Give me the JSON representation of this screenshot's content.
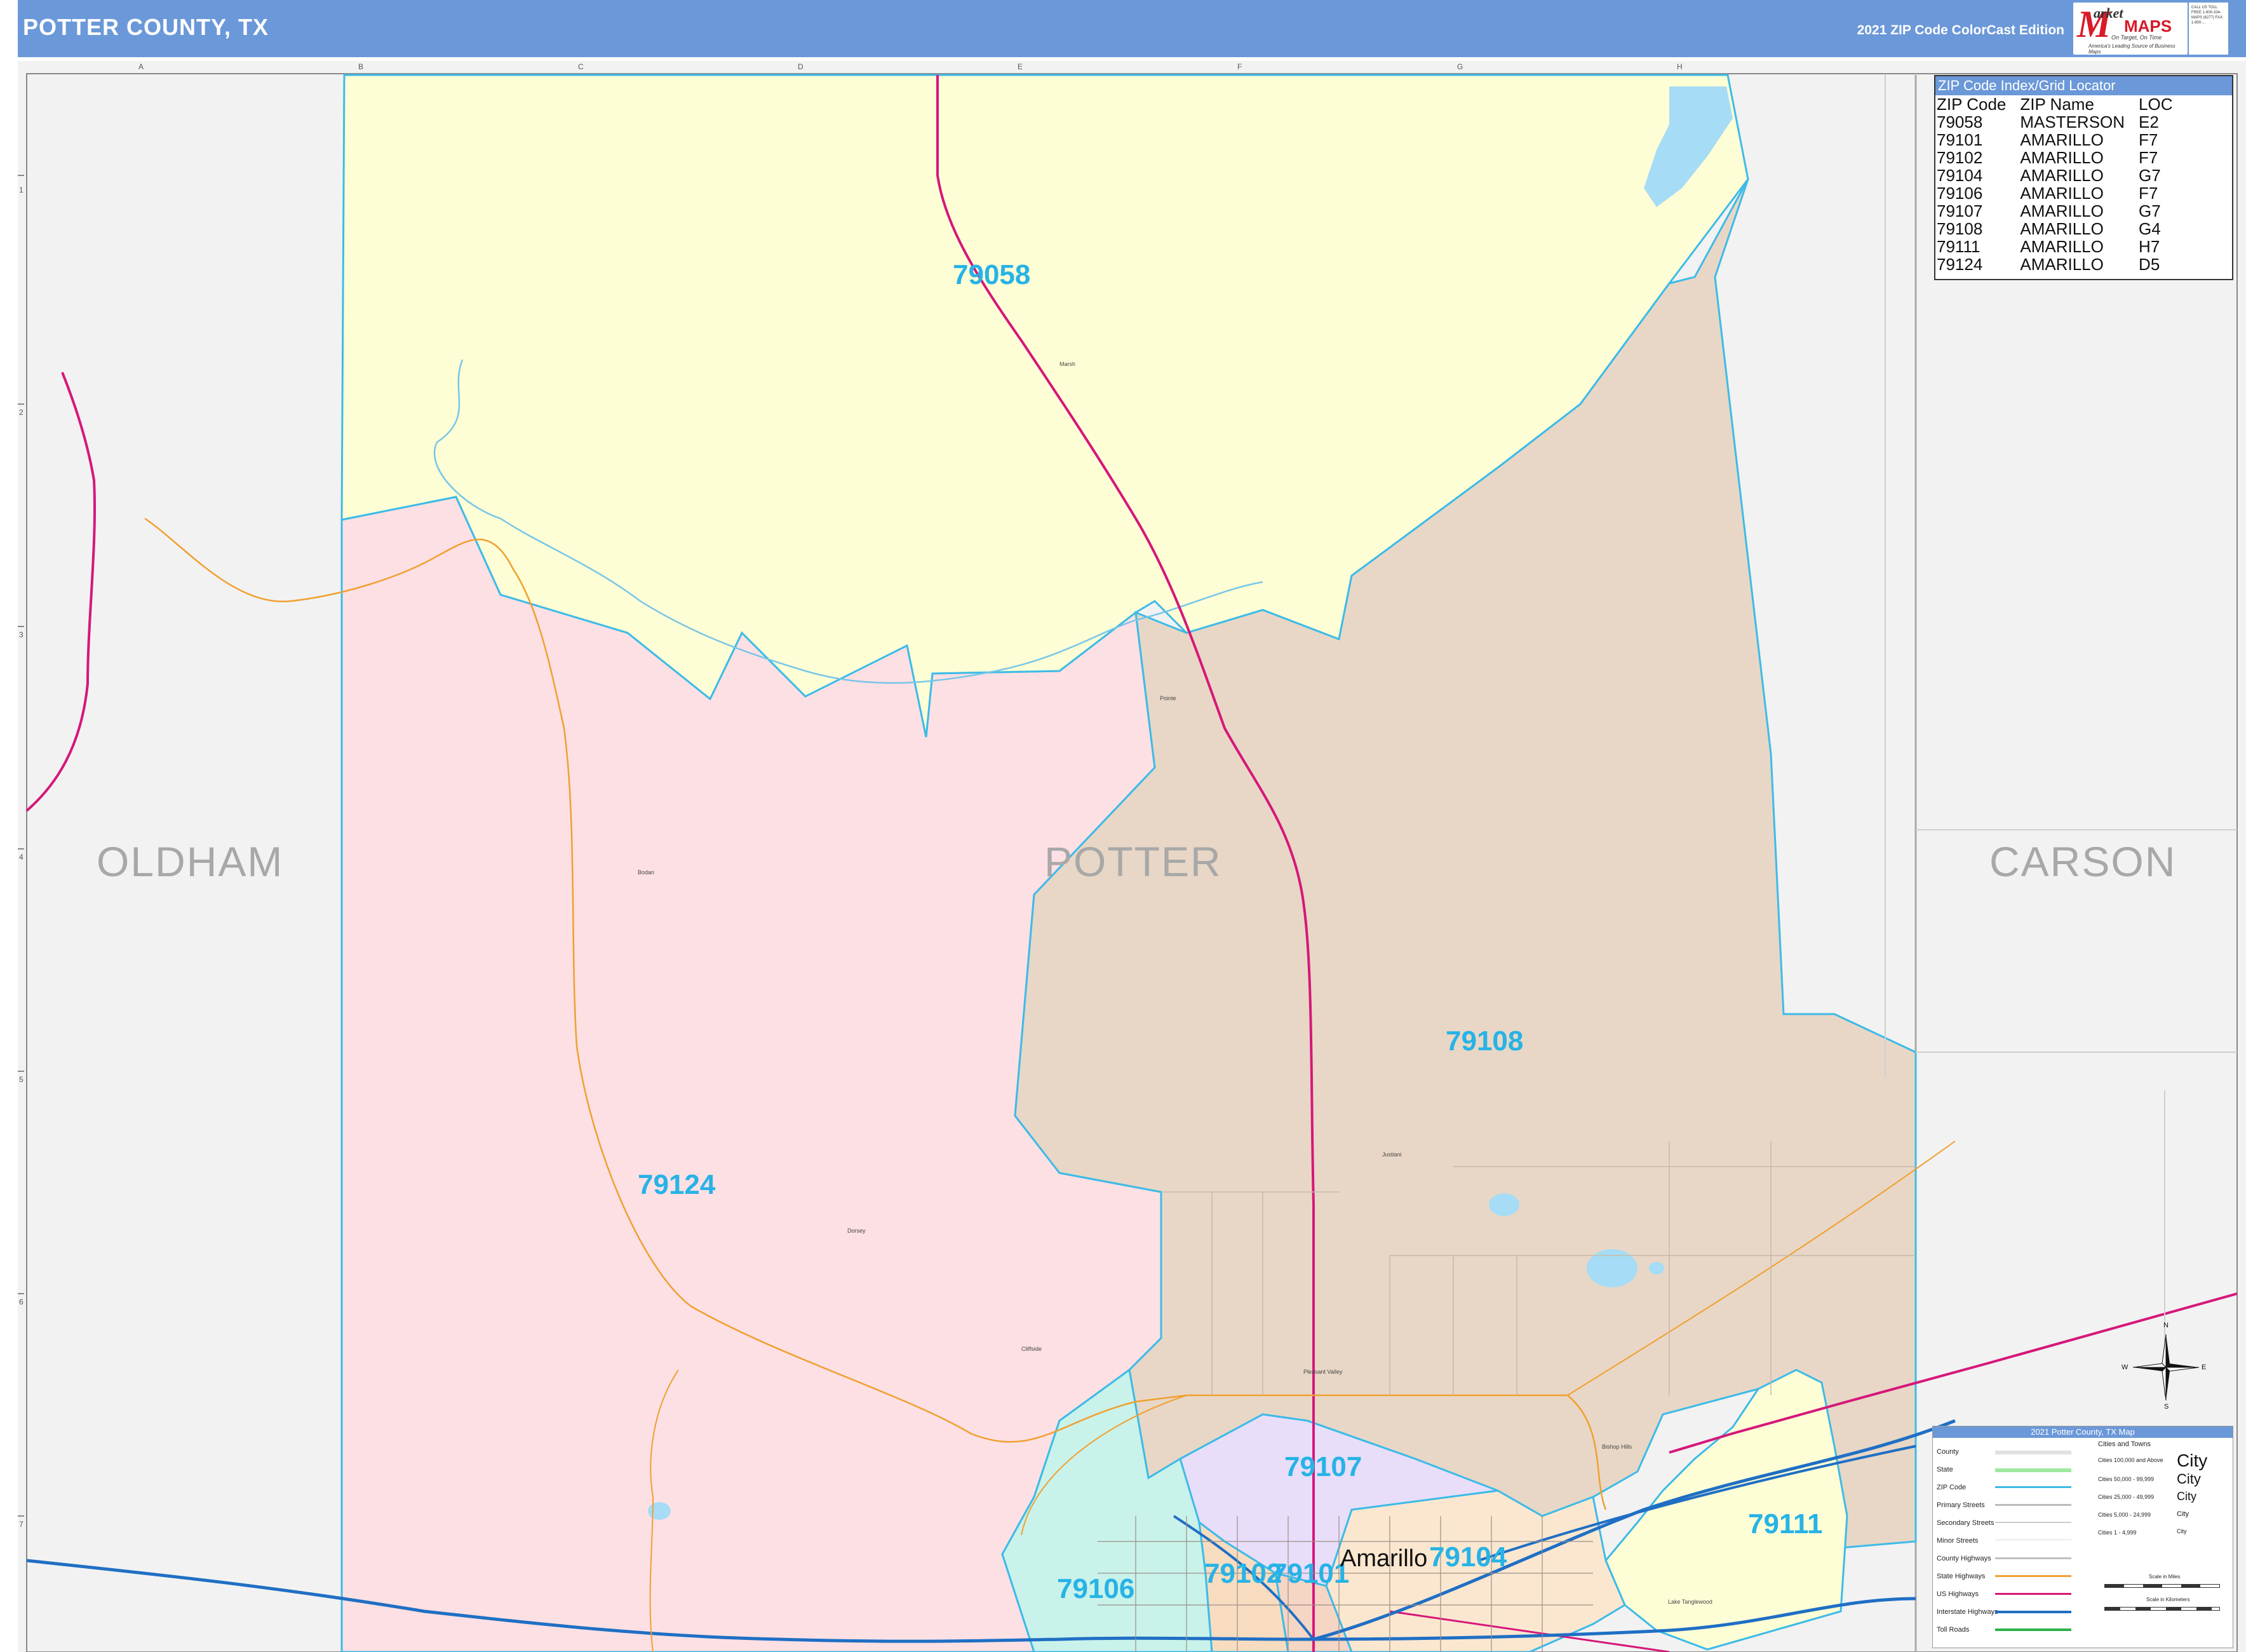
{
  "header": {
    "title": "POTTER COUNTY, TX",
    "edition": "2021 ZIP Code ColorCast Edition",
    "logo": {
      "letter": "M",
      "word1": "arket",
      "word2": "MAPS",
      "tagline1": "On Target, On Time",
      "tagline2": "America's Leading Source of Business Maps"
    },
    "contact": "CALL US TOLL FREE 1-800-334-MAPS (6277) FAX: 1-800-..."
  },
  "map": {
    "county_labels": [
      "OLDHAM",
      "POTTER",
      "CARSON"
    ],
    "zip_labels": [
      "79058",
      "79124",
      "79108",
      "79107",
      "79106",
      "79102",
      "79101",
      "79104",
      "79111"
    ],
    "city_labels": [
      "Amarillo"
    ],
    "place_labels": [
      "Marsh",
      "Bodan",
      "Pointe",
      "Justiani",
      "Dorsey",
      "Cliffside",
      "Pleasant Valley",
      "Bishop Hills",
      "Lake Tanglewood"
    ],
    "grid_columns": [
      "A",
      "B",
      "C",
      "D",
      "E",
      "F",
      "G",
      "H"
    ],
    "grid_rows": [
      "1",
      "2",
      "3",
      "4",
      "5",
      "6",
      "7"
    ],
    "colors": {
      "zip_79058": "#fefed6",
      "zip_79124": "#fde0e4",
      "zip_79108": "#e8d7c6",
      "zip_79107": "#e8defa",
      "zip_79106": "#c9f2ea",
      "zip_79104": "#fbe7d0",
      "zip_79111": "#fefed6",
      "zip_79101": "#f5d5c4",
      "zip_79102": "#f7dcc0",
      "outside": "#f2f2f2",
      "water": "#a6dcf5",
      "zip_boundary": "#3dbbe8",
      "us_highway": "#d6177a",
      "interstate": "#1f6fc4",
      "state_highway": "#f0a030",
      "label_blue": "#27b3e6"
    }
  },
  "zip_index": {
    "title": "ZIP Code Index/Grid Locator",
    "columns": [
      "ZIP Code",
      "ZIP Name",
      "LOC"
    ],
    "rows": [
      [
        "79058",
        "MASTERSON",
        "E2"
      ],
      [
        "79101",
        "AMARILLO",
        "F7"
      ],
      [
        "79102",
        "AMARILLO",
        "F7"
      ],
      [
        "79104",
        "AMARILLO",
        "G7"
      ],
      [
        "79106",
        "AMARILLO",
        "F7"
      ],
      [
        "79107",
        "AMARILLO",
        "G7"
      ],
      [
        "79108",
        "AMARILLO",
        "G4"
      ],
      [
        "79111",
        "AMARILLO",
        "H7"
      ],
      [
        "79124",
        "AMARILLO",
        "D5"
      ]
    ]
  },
  "legend": {
    "title": "2021 Potter County, TX Map",
    "items": [
      "County",
      "State",
      "ZIP Code",
      "Primary Streets",
      "Secondary Streets",
      "Minor Streets",
      "County Highways",
      "State Highways",
      "US Highways",
      "Interstate Highways",
      "Toll Roads"
    ],
    "cities_title": "Cities and Towns",
    "city_classes": [
      "Cities 100,000 and Above",
      "Cities 50,000 - 99,999",
      "Cities 25,000 - 49,999",
      "Cities 5,000 - 24,999",
      "Cities 1 - 4,999"
    ],
    "city_samples": [
      "City",
      "City",
      "City",
      "City",
      "City"
    ],
    "scale_miles": "Scale in Miles",
    "scale_km": "Scale in Kilometers"
  },
  "compass": {
    "n": "N",
    "s": "S",
    "e": "E",
    "w": "W"
  }
}
